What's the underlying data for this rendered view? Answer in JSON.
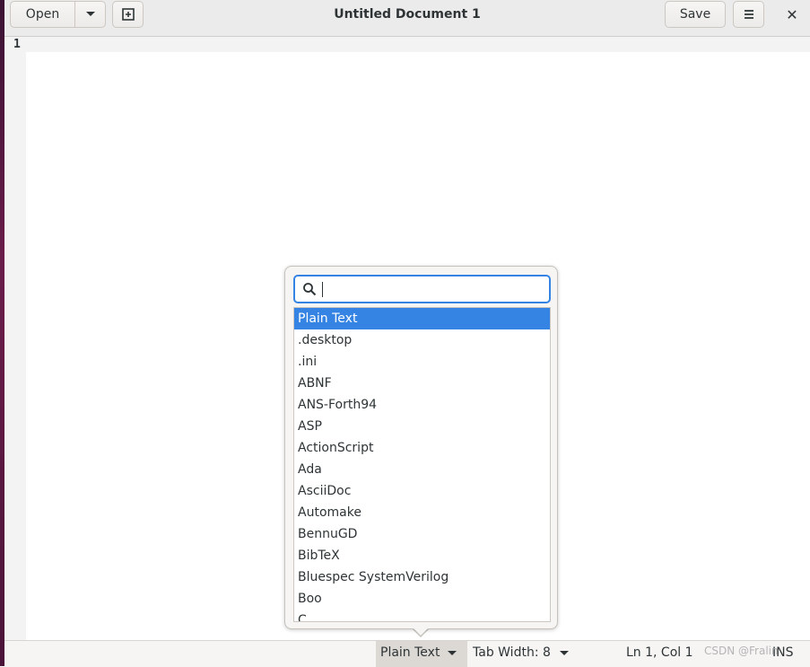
{
  "header": {
    "open_label": "Open",
    "open_menu_icon": "chevron-down-icon",
    "new_tab_icon": "new-document-icon",
    "title": "Untitled Document 1",
    "save_label": "Save",
    "menu_icon": "hamburger-menu-icon",
    "close_glyph": "✕"
  },
  "editor": {
    "line_number": "1"
  },
  "language_popover": {
    "search": {
      "placeholder": "",
      "value": ""
    },
    "selected": "Plain Text",
    "items": [
      "Plain Text",
      ".desktop",
      ".ini",
      "ABNF",
      "ANS-Forth94",
      "ASP",
      "ActionScript",
      "Ada",
      "AsciiDoc",
      "Automake",
      "BennuGD",
      "BibTeX",
      "Bluespec SystemVerilog",
      "Boo",
      "C"
    ]
  },
  "statusbar": {
    "language": "Plain Text",
    "tab_width": "Tab Width: 8",
    "position": "Ln 1, Col 1",
    "mode": "INS"
  },
  "watermark": "CSDN @Fralin",
  "colors": {
    "accent": "#3584e4",
    "headerbar": "#ebebeb",
    "statusbar": "#f6f5f4"
  }
}
